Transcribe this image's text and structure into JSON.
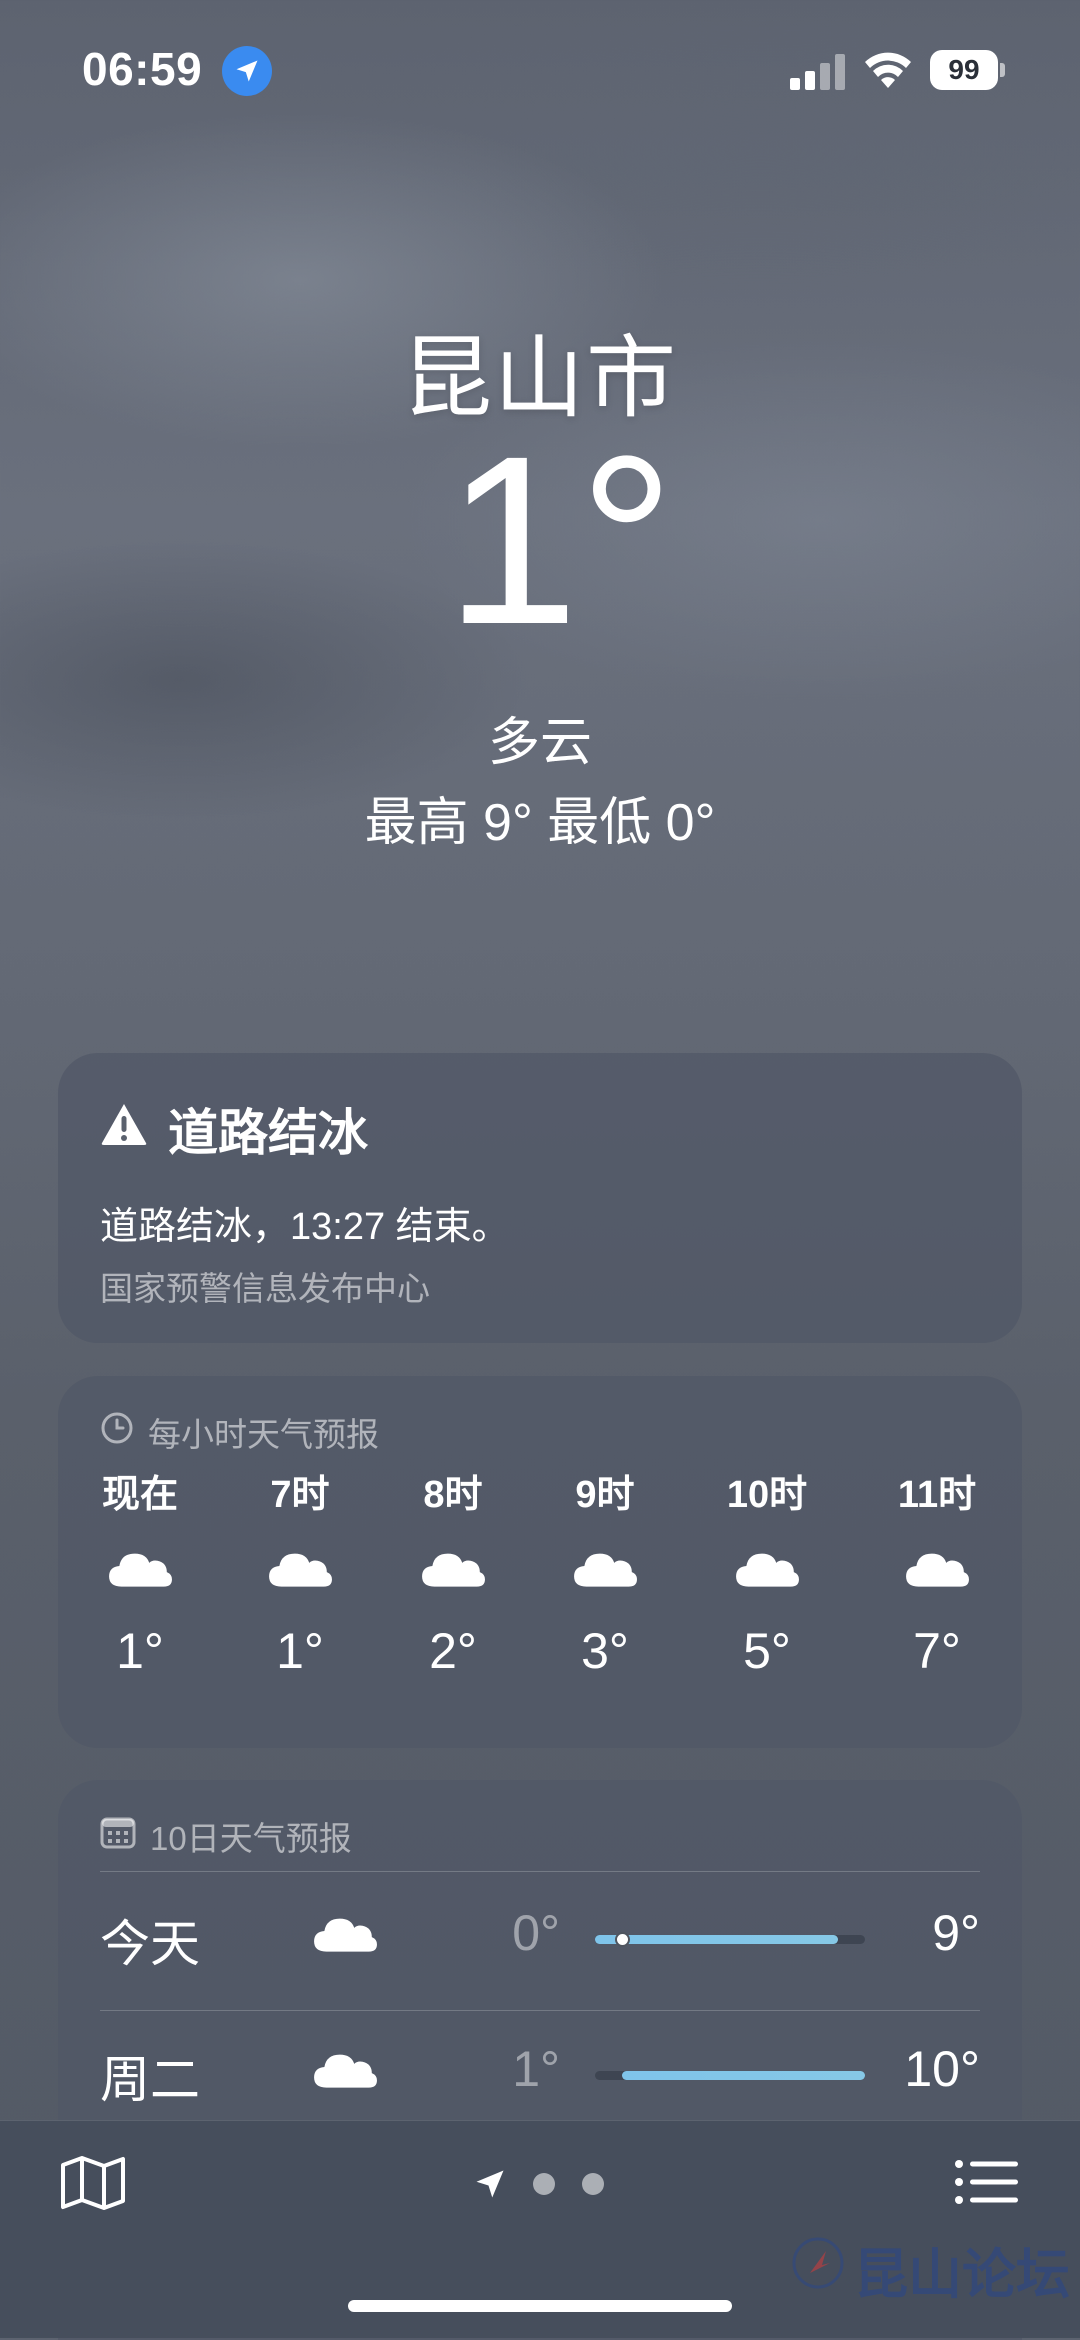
{
  "status_bar": {
    "time": "06:59",
    "battery": "99",
    "icons": [
      "location-arrow-icon",
      "cellular-signal-icon",
      "wifi-icon",
      "battery-icon"
    ]
  },
  "hero": {
    "city": "昆山市",
    "temperature": "1°",
    "condition": "多云",
    "high_low": "最高 9°  最低 0°"
  },
  "alert": {
    "title": "道路结冰",
    "body": "道路结冰，13:27 结束。",
    "source": "国家预警信息发布中心",
    "icon": "warning-triangle-icon"
  },
  "hourly": {
    "header": "每小时天气预报",
    "icon": "clock-icon",
    "items": [
      {
        "label": "现在",
        "temp": "1°",
        "icon": "cloud-icon"
      },
      {
        "label": "7时",
        "temp": "1°",
        "icon": "cloud-icon"
      },
      {
        "label": "8时",
        "temp": "2°",
        "icon": "cloud-icon"
      },
      {
        "label": "9时",
        "temp": "3°",
        "icon": "cloud-icon"
      },
      {
        "label": "10时",
        "temp": "5°",
        "icon": "cloud-icon"
      },
      {
        "label": "11时",
        "temp": "7°",
        "icon": "cloud-icon"
      }
    ]
  },
  "daily": {
    "header": "10日天气预报",
    "icon": "calendar-icon",
    "range_min": 0,
    "range_max": 10,
    "days": [
      {
        "label": "今天",
        "low": "0°",
        "high": "9°",
        "low_value": 0,
        "high_value": 9,
        "current_value": 1,
        "icon": "cloud-icon"
      },
      {
        "label": "周二",
        "low": "1°",
        "high": "10°",
        "low_value": 1,
        "high_value": 10,
        "icon": "cloud-icon"
      }
    ]
  },
  "toolbar": {
    "icons": [
      "map-icon",
      "location-arrow-icon",
      "page-dot",
      "page-dot",
      "list-icon"
    ]
  },
  "watermark": {
    "text": "昆山论坛"
  },
  "colors": {
    "accent_blue": "#3a8bf0",
    "temp_bar": "#7fc4ea"
  }
}
